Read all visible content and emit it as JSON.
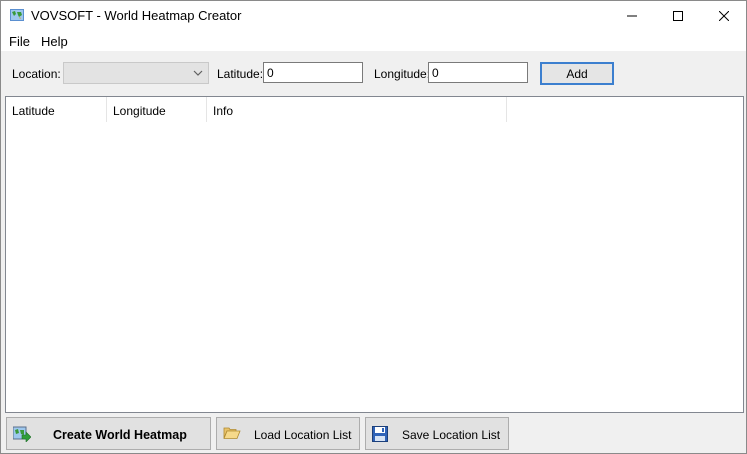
{
  "window": {
    "title": "VOVSOFT - World Heatmap Creator"
  },
  "menu": {
    "items": [
      {
        "label": "File"
      },
      {
        "label": "Help"
      }
    ]
  },
  "toolbar": {
    "location_label": "Location:",
    "location_value": "",
    "latitude_label": "Latitude:",
    "latitude_value": "0",
    "longitude_label": "Longitude:",
    "longitude_value": "0",
    "add_label": "Add"
  },
  "table": {
    "columns": [
      "Latitude",
      "Longitude",
      "Info"
    ],
    "rows": []
  },
  "buttons": {
    "create": "Create World Heatmap",
    "load": "Load Location List",
    "save": "Save Location List"
  },
  "colors": {
    "focus_border": "#3c7fcf",
    "window_bg": "#f0f0f0"
  },
  "icons": {
    "app": "world-map-icon",
    "create": "map-arrow-icon",
    "load": "open-folder-icon",
    "save": "floppy-disk-icon"
  }
}
